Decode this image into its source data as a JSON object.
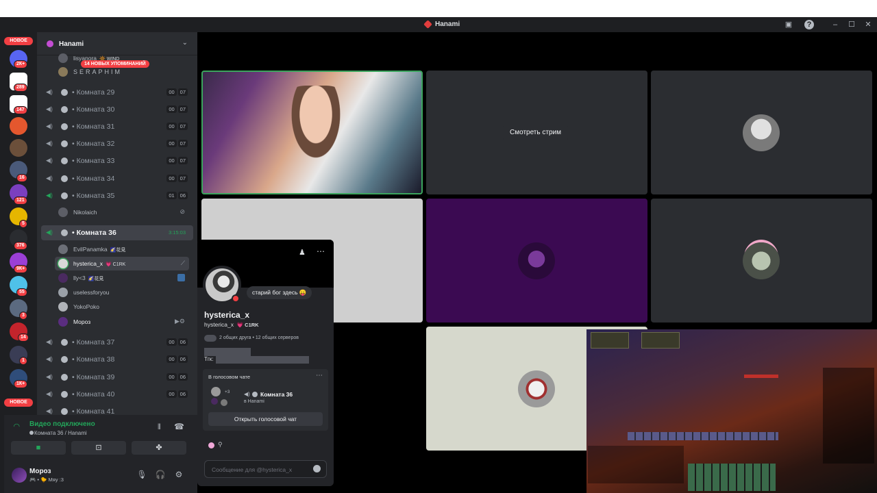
{
  "window": {
    "title": "Hanami"
  },
  "rail": {
    "new_top": "НОВОЕ",
    "new_bottom": "НОВОЕ",
    "badges": [
      "2К+",
      "289",
      "147",
      "16",
      "121",
      "5",
      "376",
      "9К+",
      "55",
      "3",
      "14",
      "1",
      "1К+"
    ]
  },
  "server": {
    "name": "Hanami",
    "mention_pill": "14 НОВЫХ УПОМИНАНИЙ"
  },
  "top_users": [
    {
      "name": "lisyanora",
      "tag": "🔆 WIND"
    },
    {
      "name": "SERAPHIM",
      "tag": ""
    }
  ],
  "channels": [
    {
      "name": "Комната 29",
      "a": "00",
      "b": "07"
    },
    {
      "name": "Комната 30",
      "a": "00",
      "b": "07"
    },
    {
      "name": "Комната 31",
      "a": "00",
      "b": "07"
    },
    {
      "name": "Комната 32",
      "a": "00",
      "b": "07"
    },
    {
      "name": "Комната 33",
      "a": "00",
      "b": "07"
    },
    {
      "name": "Комната 34",
      "a": "00",
      "b": "07"
    },
    {
      "name": "Комната 35",
      "a": "01",
      "b": "06"
    }
  ],
  "room35_user": "Nikolaich",
  "active_channel": {
    "name": "Комната 36",
    "timer": "3:15:03"
  },
  "room36_users": [
    {
      "name": "EvilPanamka",
      "tag": "🌠花見"
    },
    {
      "name": "hysterica_x",
      "tag": "💗 C1RK"
    },
    {
      "name": "lly<3",
      "tag": "🌠花見"
    },
    {
      "name": "uselessforyou",
      "tag": ""
    },
    {
      "name": "YokoPoko",
      "tag": ""
    },
    {
      "name": "Мороз",
      "tag": ""
    }
  ],
  "channels_after": [
    {
      "name": "Комната 37",
      "a": "00",
      "b": "06"
    },
    {
      "name": "Комната 38",
      "a": "00",
      "b": "06"
    },
    {
      "name": "Комната 39",
      "a": "00",
      "b": "06"
    },
    {
      "name": "Комната 40",
      "a": "00",
      "b": "06"
    },
    {
      "name": "Комната 41",
      "a": "",
      "b": ""
    }
  ],
  "voice": {
    "status": "Видео подключено",
    "location": "Комната 36 / Hanami"
  },
  "me": {
    "name": "Мороз",
    "status": "🎮 • 🐤 Мяу :3"
  },
  "stage": {
    "watch_stream": "Смотреть стрим"
  },
  "profile": {
    "bubble": "старий бог здесь 😛",
    "display_name": "hysterica_x",
    "handle": "hysterica_x",
    "tag": "💗 C1RK",
    "mutual": "2 общих друга • 12 общих серверов",
    "tg_label": "Тгк:",
    "voice_header": "В голосовом чате",
    "voice_more": "+3",
    "voice_channel": "Комната 36",
    "voice_server": "в Hanami",
    "open_voice": "Открыть голосовой чат",
    "message_placeholder": "Сообщение для @hysterica_x"
  },
  "colors": {
    "accent_red": "#f23f43",
    "online_green": "#23a55a",
    "speaking_green": "#3ba55d",
    "purple_tile": "#3b0a52"
  }
}
